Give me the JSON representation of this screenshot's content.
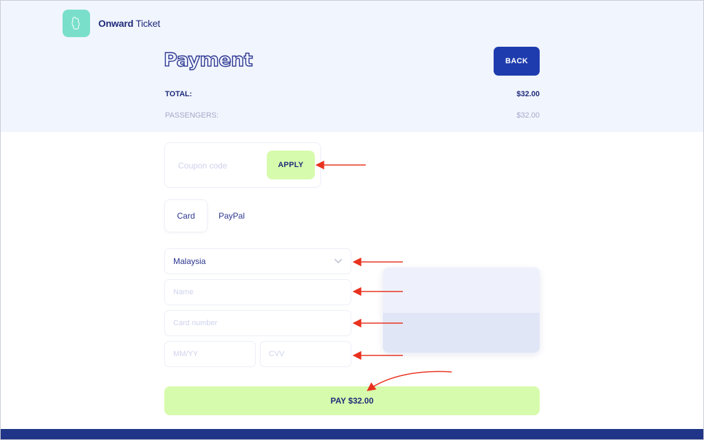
{
  "brand": {
    "name_bold": "Onward",
    "name_light": "Ticket",
    "logo_icon": "ticket-icon"
  },
  "header": {
    "title": "Payment",
    "back_label": "BACK"
  },
  "summary": {
    "total_label": "TOTAL:",
    "total_value": "$32.00",
    "passengers_label": "PASSENGERS:",
    "passengers_value": "$32.00"
  },
  "coupon": {
    "placeholder": "Coupon code",
    "value": "",
    "apply_label": "APPLY"
  },
  "payment_tabs": [
    {
      "label": "Card",
      "active": true
    },
    {
      "label": "PayPal",
      "active": false
    }
  ],
  "form": {
    "country": {
      "selected": "Malaysia",
      "icon": "chevron-down-icon"
    },
    "name": {
      "placeholder": "Name",
      "value": ""
    },
    "card_number": {
      "placeholder": "Card number",
      "value": ""
    },
    "expiry": {
      "placeholder": "MM/YY",
      "value": ""
    },
    "cvv": {
      "placeholder": "CVV",
      "value": ""
    }
  },
  "pay_button": {
    "label": "PAY $32.00"
  },
  "colors": {
    "header_bg": "#f1f5fe",
    "primary": "#1e3cae",
    "text_dark": "#1e2a78",
    "accent_green": "#d7fbad",
    "logo_teal": "#79dfcb",
    "footer": "#203587",
    "annotation_red": "#e8321f"
  }
}
